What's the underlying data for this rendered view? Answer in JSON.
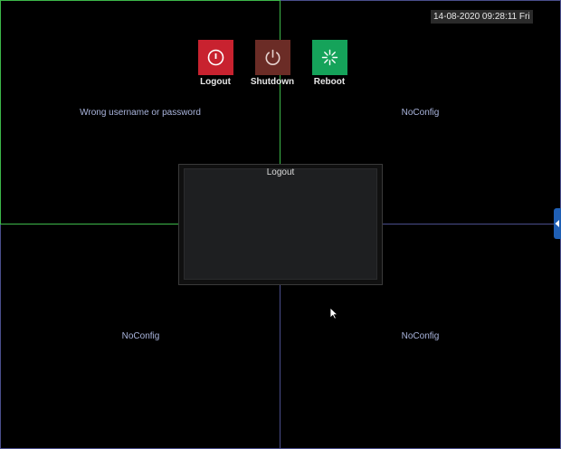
{
  "clock": {
    "text": "14-08-2020 09:28:11 Fri"
  },
  "tiles": [
    {
      "label": "Wrong username or password"
    },
    {
      "label": "NoConfig"
    },
    {
      "label": "NoConfig"
    },
    {
      "label": "NoConfig"
    }
  ],
  "dialog": {
    "title": "Logout",
    "actions": [
      {
        "label": "Logout",
        "icon": "power-circle-icon",
        "color": "#c8222f"
      },
      {
        "label": "Shutdown",
        "icon": "power-icon",
        "color": "#6b2c26"
      },
      {
        "label": "Reboot",
        "icon": "reboot-spinner-icon",
        "color": "#15a35a"
      }
    ]
  },
  "colors": {
    "selected_tile_border": "#3db84a",
    "tile_border": "#4a4e8c",
    "side_handle": "#1f5fb5"
  },
  "side_handle": {
    "icon": "chevron-left-icon"
  }
}
